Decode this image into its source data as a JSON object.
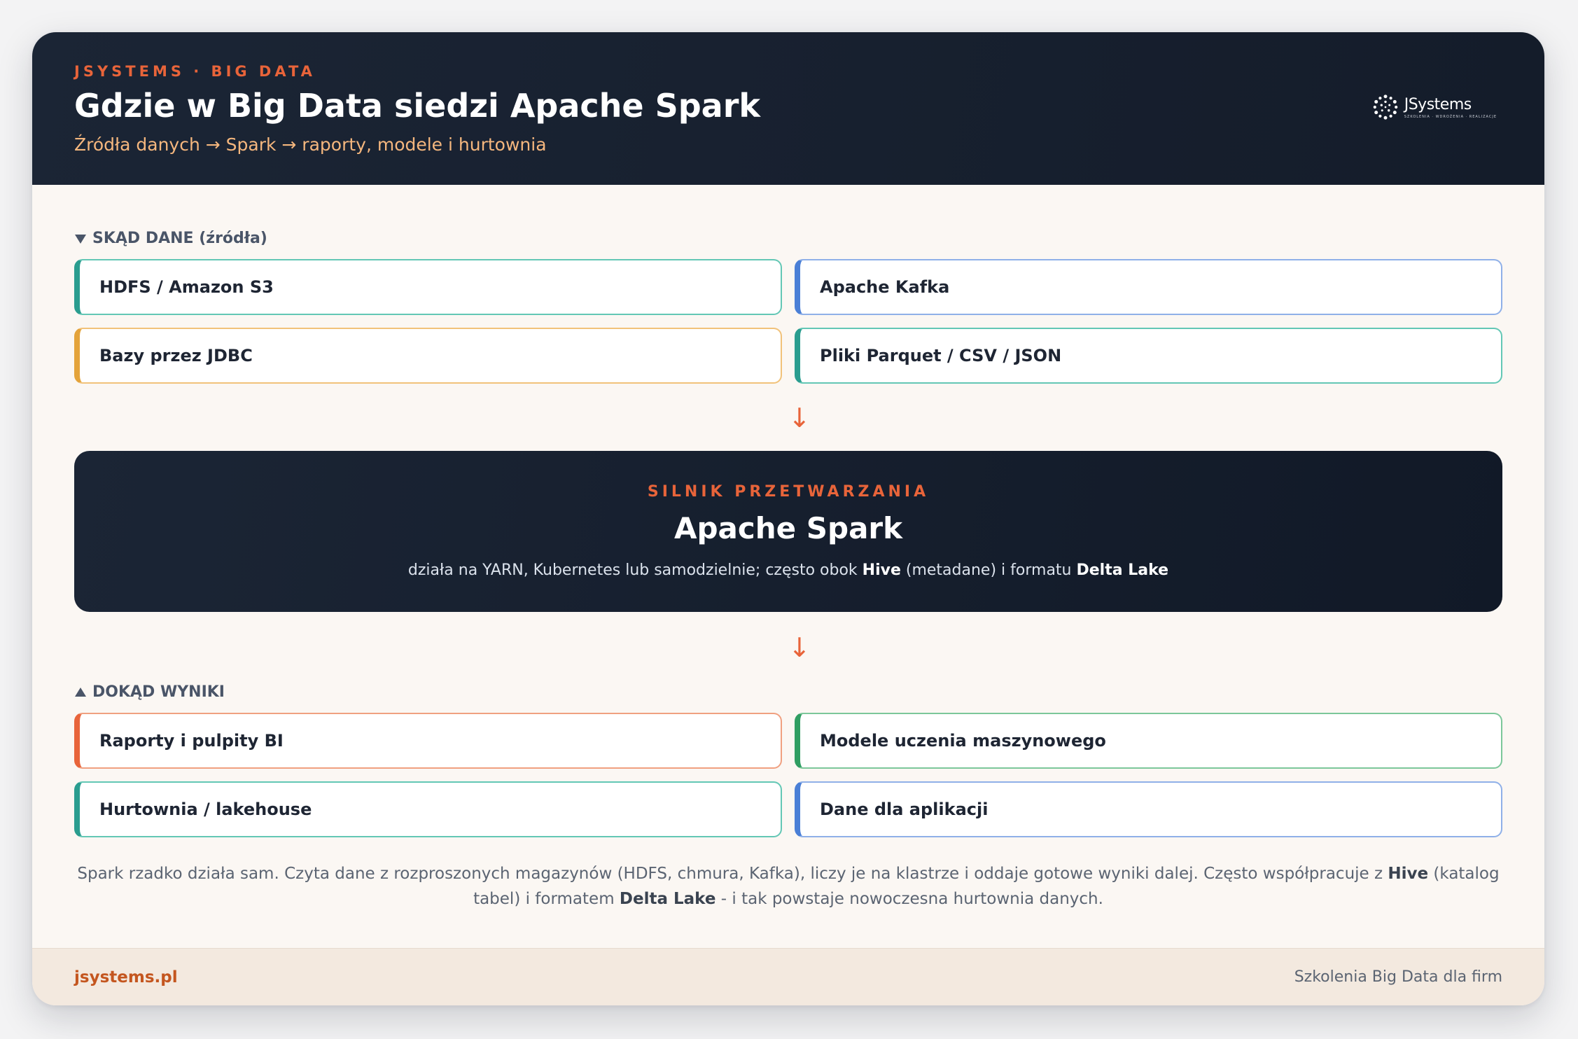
{
  "header": {
    "eyebrow": "JSYSTEMS · BIG DATA",
    "title": "Gdzie w Big Data siedzi Apache Spark",
    "subtitle": "Źródła danych → Spark → raporty, modele i hurtownia",
    "logo_text": "JSystems",
    "logo_tagline": "SZKOLENIA · WDROŻENIA · REALIZACJE"
  },
  "sources": {
    "label": "SKĄD DANE (źródła)",
    "items": [
      "HDFS / Amazon S3",
      "Apache Kafka",
      "Bazy przez JDBC",
      "Pliki Parquet / CSV / JSON"
    ]
  },
  "engine": {
    "eyebrow": "SILNIK PRZETWARZANIA",
    "title": "Apache Spark",
    "desc_pre": "działa na YARN, Kubernetes lub samodzielnie; często obok ",
    "desc_b1": "Hive",
    "desc_mid": " (metadane) i formatu ",
    "desc_b2": "Delta Lake"
  },
  "outputs": {
    "label": "DOKĄD WYNIKI",
    "items": [
      "Raporty i pulpity BI",
      "Modele uczenia maszynowego",
      "Hurtownia / lakehouse",
      "Dane dla aplikacji"
    ]
  },
  "note": {
    "part1": "Spark rzadko działa sam. Czyta dane z rozproszonych magazynów (HDFS, chmura, Kafka), liczy je na klastrze i oddaje gotowe wyniki dalej. Często współpracuje z ",
    "b1": "Hive",
    "part2": " (katalog tabel) i formatem ",
    "b2": "Delta Lake",
    "part3": " - i tak powstaje nowoczesna hurtownia danych."
  },
  "footer": {
    "left": "jsystems.pl",
    "right": "Szkolenia Big Data dla firm"
  },
  "colors": {
    "accent": "#e8643a",
    "dark": "#141c2a",
    "teal": "#2a9d8f",
    "blue": "#4a7fd6",
    "amber": "#e4a33a",
    "green": "#2f9e62"
  },
  "icons": {
    "sources_marker": "triangle-down-icon",
    "outputs_marker": "triangle-up-icon",
    "flow_arrow": "arrow-down-icon"
  }
}
